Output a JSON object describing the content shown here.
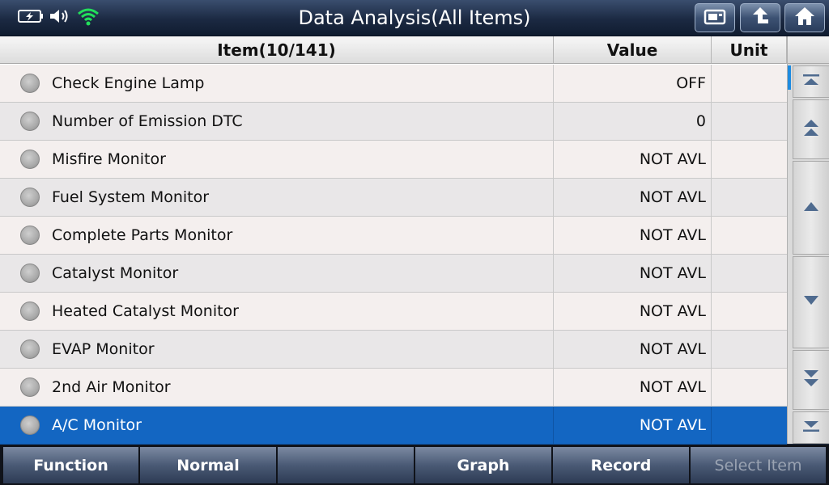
{
  "header": {
    "title": "Data Analysis(All Items)"
  },
  "status_icons": [
    "battery-icon",
    "volume-icon",
    "wifi-icon"
  ],
  "toolbar_icons": [
    "print-icon",
    "back-icon",
    "home-icon"
  ],
  "table": {
    "columns": {
      "item": "Item(10/141)",
      "value": "Value",
      "unit": "Unit"
    },
    "rows": [
      {
        "item": "Check Engine Lamp",
        "value": "OFF",
        "unit": ""
      },
      {
        "item": "Number of Emission DTC",
        "value": "0",
        "unit": ""
      },
      {
        "item": "Misfire Monitor",
        "value": "NOT AVL",
        "unit": ""
      },
      {
        "item": "Fuel System Monitor",
        "value": "NOT AVL",
        "unit": ""
      },
      {
        "item": "Complete Parts Monitor",
        "value": "NOT AVL",
        "unit": ""
      },
      {
        "item": "Catalyst Monitor",
        "value": "NOT AVL",
        "unit": ""
      },
      {
        "item": "Heated Catalyst Monitor",
        "value": "NOT AVL",
        "unit": ""
      },
      {
        "item": "EVAP Monitor",
        "value": "NOT AVL",
        "unit": ""
      },
      {
        "item": "2nd Air Monitor",
        "value": "NOT AVL",
        "unit": ""
      },
      {
        "item": "A/C Monitor",
        "value": "NOT AVL",
        "unit": ""
      }
    ],
    "selected_index": 9
  },
  "scroll_buttons": [
    "scroll-top-icon",
    "page-up-icon",
    "line-up-icon",
    "line-down-icon",
    "page-down-icon",
    "scroll-bottom-icon"
  ],
  "bottom": {
    "function": "Function",
    "normal": "Normal",
    "empty": "",
    "graph": "Graph",
    "record": "Record",
    "select_item": "Select Item"
  },
  "colors": {
    "selected_row": "#1366c2",
    "title_bar": "#1b2942",
    "wifi": "#22e05a"
  }
}
